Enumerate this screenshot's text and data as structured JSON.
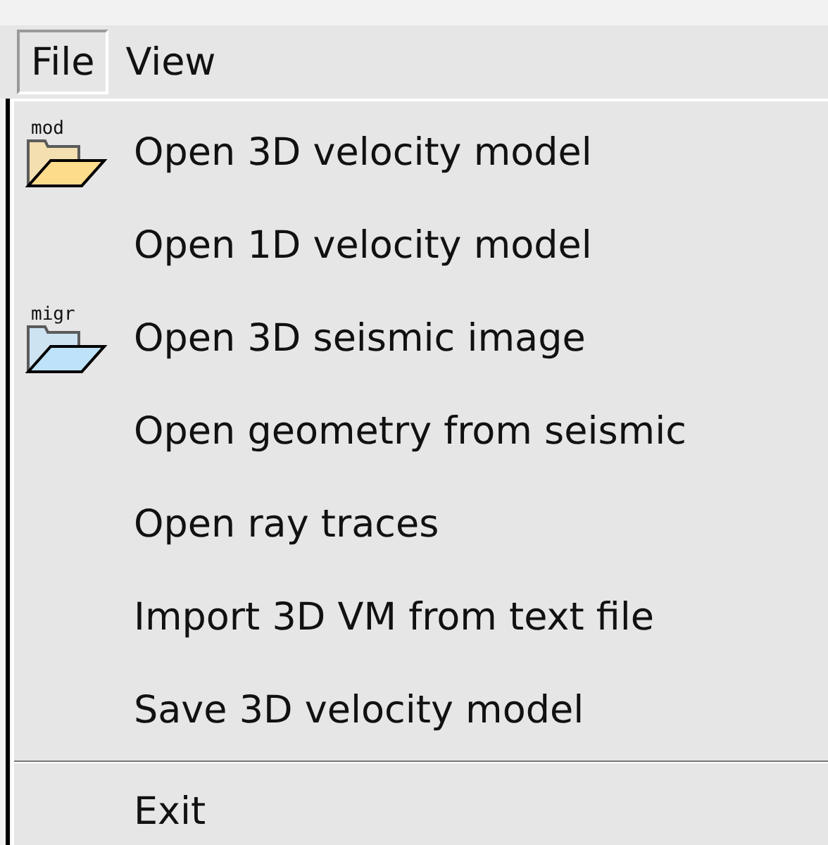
{
  "menubar": [
    {
      "label": "File",
      "selected": true
    },
    {
      "label": "View",
      "selected": false
    }
  ],
  "menu": {
    "items": [
      {
        "kind": "item",
        "label": "Open 3D velocity model",
        "icon_label": "mod",
        "color": "#fddc8c"
      },
      {
        "kind": "item",
        "label": "Open 1D velocity model"
      },
      {
        "kind": "item",
        "label": "Open 3D seismic image",
        "icon_label": "migr",
        "color": "#bde2fa"
      },
      {
        "kind": "item",
        "label": "Open geometry from seismic"
      },
      {
        "kind": "item",
        "label": "Open ray traces"
      },
      {
        "kind": "item",
        "label": "Import 3D VM from text file"
      },
      {
        "kind": "item",
        "label": "Save 3D velocity model"
      },
      {
        "kind": "separator"
      },
      {
        "kind": "item",
        "label": "Exit"
      }
    ]
  }
}
